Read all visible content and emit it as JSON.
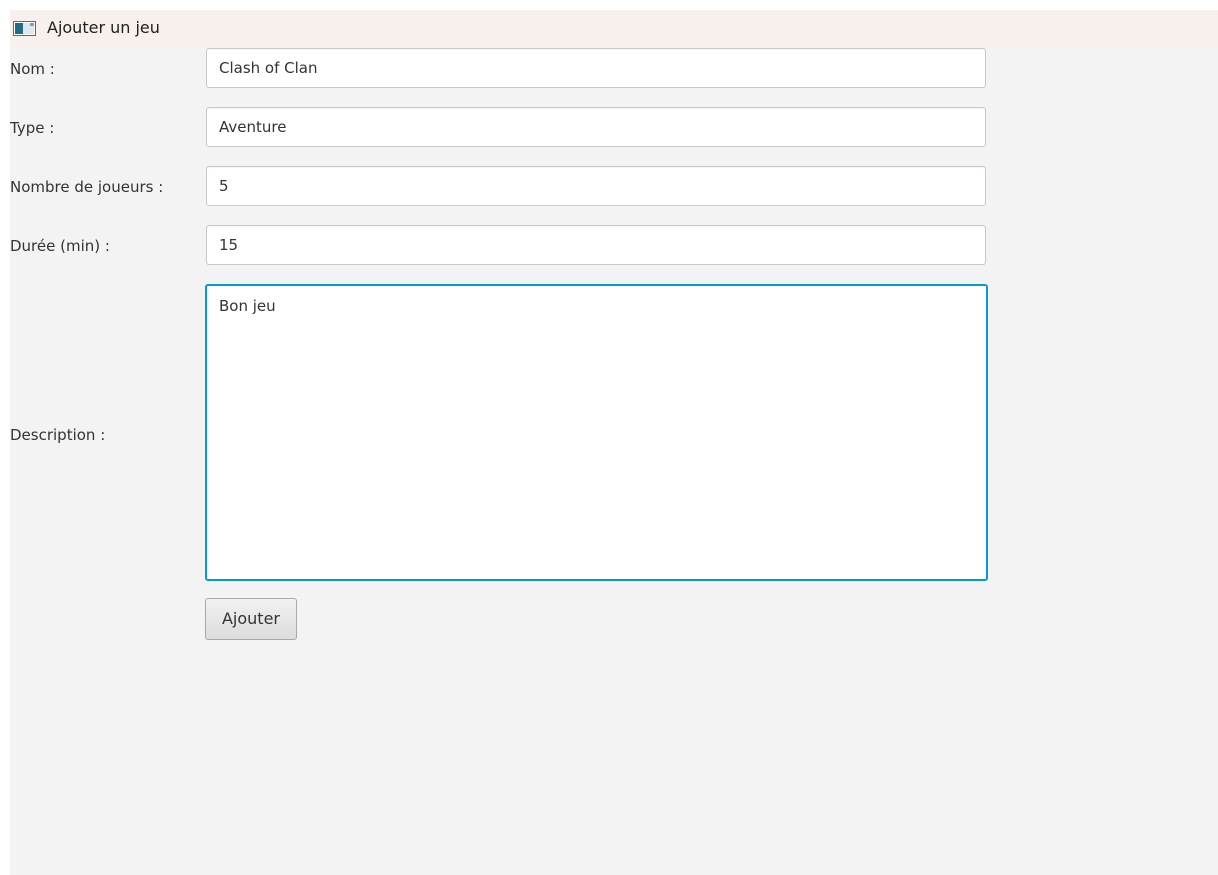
{
  "window": {
    "title": "Ajouter un jeu",
    "icon": "application-window-icon"
  },
  "form": {
    "nom": {
      "label": "Nom :",
      "value": "Clash of Clan"
    },
    "type": {
      "label": "Type :",
      "value": "Aventure"
    },
    "nombre_joueurs": {
      "label": "Nombre de joueurs :",
      "value": "5"
    },
    "duree": {
      "label": "Durée (min) :",
      "value": "15"
    },
    "description": {
      "label": "Description :",
      "value": "Bon jeu"
    },
    "submit_label": "Ajouter"
  },
  "colors": {
    "focus_accent": "#0a97d9",
    "background": "#f3f3f3",
    "titlebar": "#f8f0ec"
  }
}
